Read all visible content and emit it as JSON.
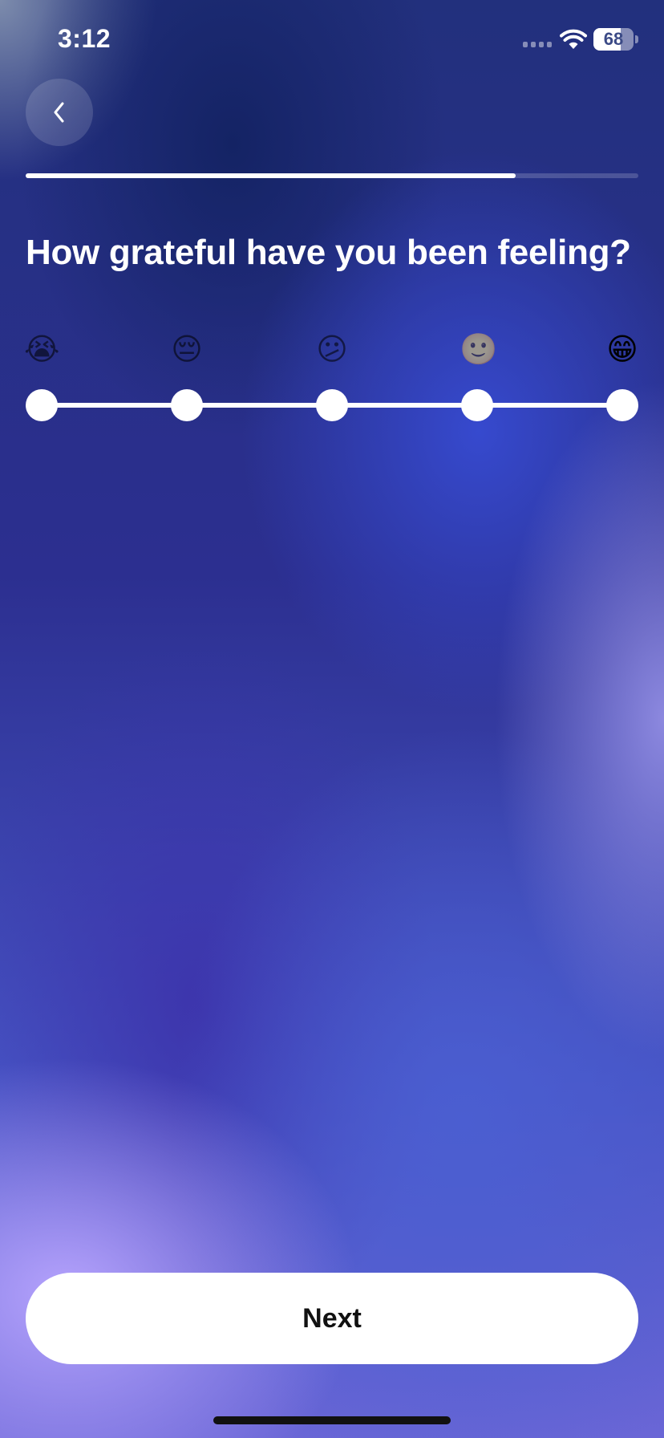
{
  "status_bar": {
    "time": "3:12",
    "battery_level": "68",
    "battery_fraction": 0.68
  },
  "header": {
    "back_icon": "chevron-left-icon",
    "progress_fraction": 0.8
  },
  "question": {
    "text": "How grateful have you been feeling?"
  },
  "scale": {
    "options": [
      {
        "emoji": "😭",
        "name": "loudly-crying-face",
        "dim": true
      },
      {
        "emoji": "😔",
        "name": "pensive-face",
        "dim": true
      },
      {
        "emoji": "😕",
        "name": "confused-face",
        "dim": true
      },
      {
        "emoji": "🙂",
        "name": "slightly-smiling-face",
        "dim": true
      },
      {
        "emoji": "😁",
        "name": "beaming-face",
        "dim": false
      }
    ],
    "selected_index": 4
  },
  "footer": {
    "next_label": "Next"
  },
  "colors": {
    "background_dark": "#22307d",
    "background_light": "#baa6ff",
    "button_bg": "#ffffff",
    "button_text": "#111111"
  }
}
